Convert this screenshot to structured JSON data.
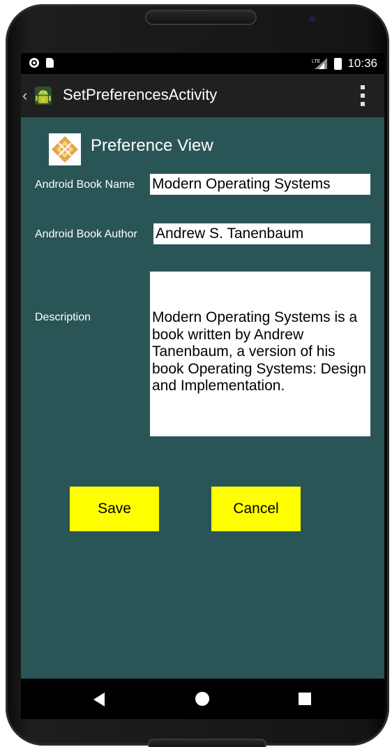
{
  "status_bar": {
    "time": "10:36",
    "signal_label": "LTE",
    "icons": [
      "notification-dot-icon",
      "sd-card-icon",
      "signal-icon",
      "battery-icon"
    ]
  },
  "action_bar": {
    "title": "SetPreferencesActivity",
    "back_glyph": "‹",
    "icons": [
      "android-app-icon",
      "overflow-menu-icon"
    ]
  },
  "preference": {
    "title": "Preference View",
    "logo_icon": "diamond-logo-icon",
    "book_name_label": "Android Book Name",
    "book_name_value": "Modern Operating Systems",
    "book_author_label": "Android Book Author",
    "book_author_value": "Andrew S. Tanenbaum",
    "description_label": "Description",
    "description_value": "Modern Operating Systems is a book written by Andrew Tanenbaum, a version of his book Operating Systems: Design and Implementation."
  },
  "buttons": {
    "save_label": "Save",
    "cancel_label": "Cancel"
  },
  "nav_bar": {
    "icons": [
      "back-triangle-icon",
      "home-circle-icon",
      "recents-square-icon"
    ]
  },
  "colors": {
    "screen_background": "#2a5557",
    "action_bar": "#202020",
    "button_background": "#ffff00",
    "field_background": "#ffffff",
    "logo_accent": "#e0a84a"
  }
}
